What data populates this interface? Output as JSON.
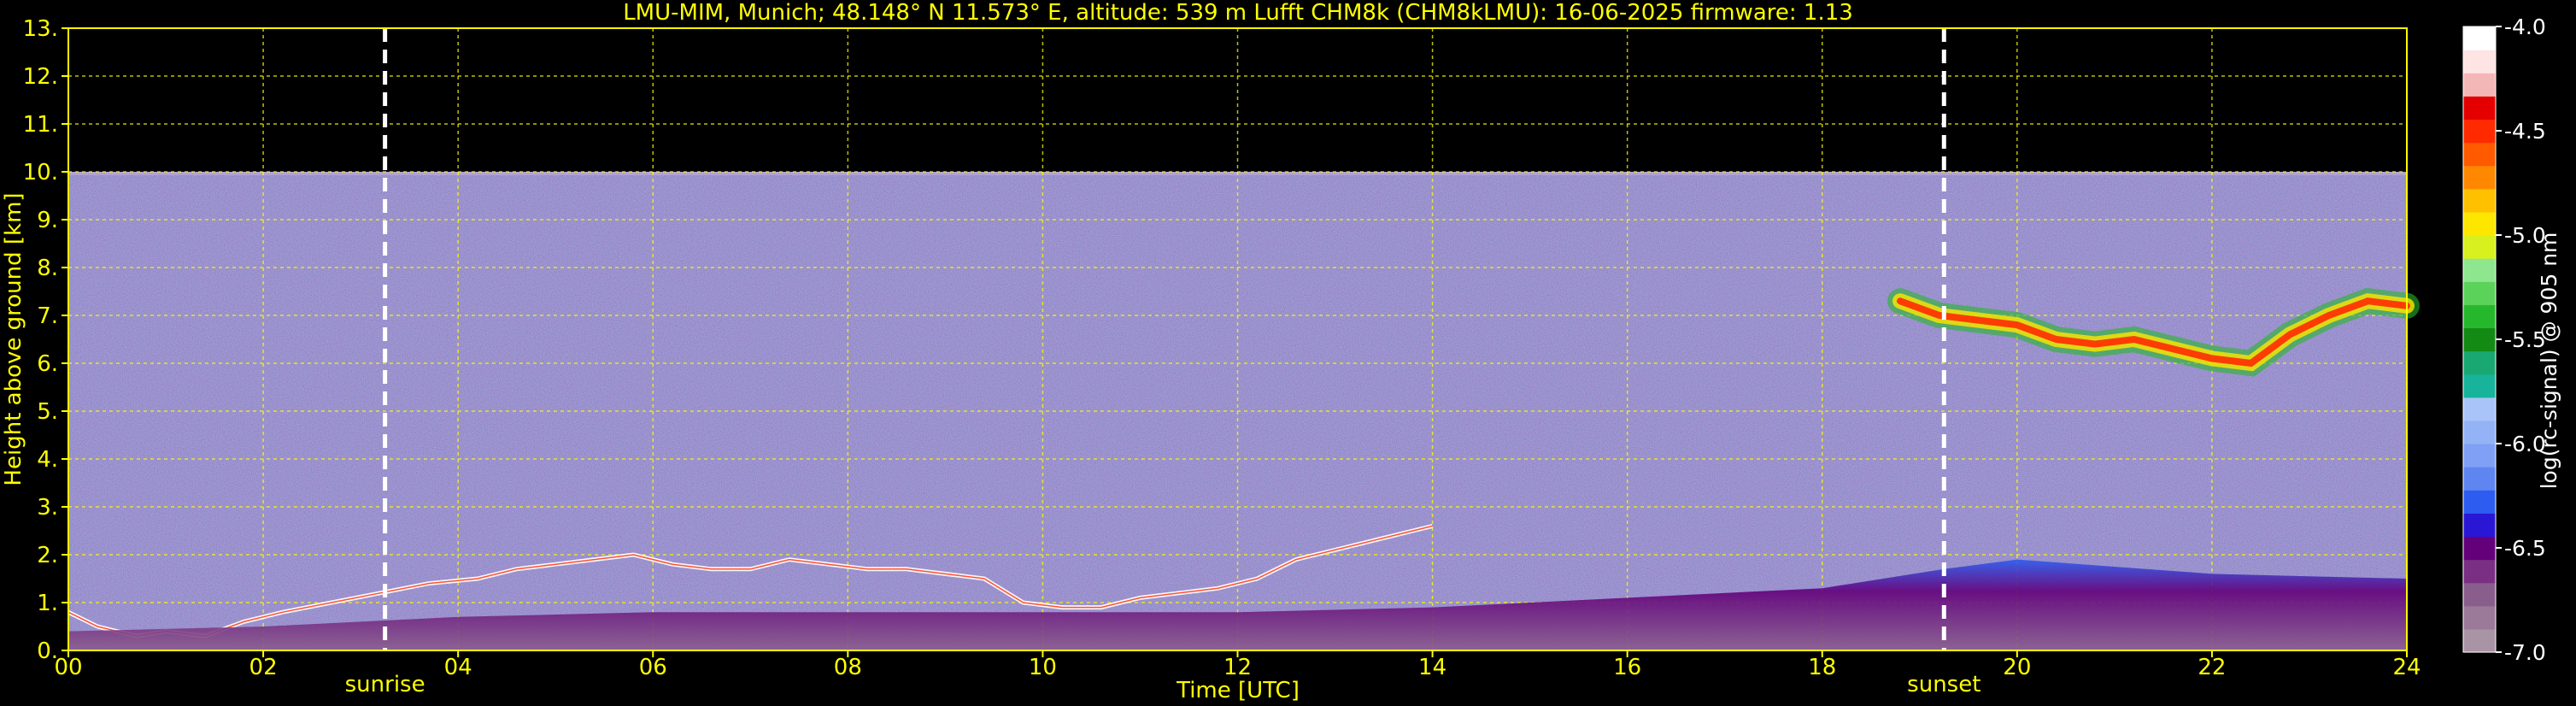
{
  "chart_data": {
    "type": "heatmap",
    "title": "LMU-MIM, Munich; 48.148° N 11.573° E, altitude: 539 m    Lufft CHM8k (CHM8kLMU): 16-06-2025    firmware: 1.13",
    "xlabel": "Time [UTC]",
    "ylabel": "Height above ground [km]",
    "xlim": [
      0,
      24
    ],
    "ylim": [
      0,
      13
    ],
    "x_ticks": [
      "00",
      "02",
      "04",
      "06",
      "08",
      "10",
      "12",
      "14",
      "16",
      "18",
      "20",
      "22",
      "24"
    ],
    "y_ticks": [
      "0.",
      "1.",
      "2.",
      "3.",
      "4.",
      "5.",
      "6.",
      "7.",
      "8.",
      "9.",
      "10.",
      "11.",
      "12.",
      "13."
    ],
    "grid": true,
    "data_ceiling_km": 10,
    "colorbar": {
      "label": "log(rc-signal) @ 905 nm",
      "range": [
        -7.0,
        -4.0
      ],
      "ticks": [
        "-4.0",
        "-4.5",
        "-5.0",
        "-5.5",
        "-6.0",
        "-6.5",
        "-7.0"
      ],
      "colors": [
        "#a994a6",
        "#9a7a98",
        "#8a5e8c",
        "#7a2f84",
        "#63007a",
        "#2a17d6",
        "#2c5cf0",
        "#5f86f0",
        "#7fa0f4",
        "#94b2f6",
        "#a9c4f8",
        "#17b39a",
        "#1aa872",
        "#128a14",
        "#26b82c",
        "#5bd35b",
        "#8ee68e",
        "#d7f01e",
        "#ffe600",
        "#ffc000",
        "#ff8800",
        "#ff5a00",
        "#ff2a00",
        "#e40000",
        "#f4b7b7",
        "#ffe4e4",
        "#ffffff"
      ]
    },
    "annotations": [
      {
        "label": "sunrise",
        "x": 3.25
      },
      {
        "label": "sunset",
        "x": 19.25
      }
    ],
    "layers": [
      {
        "kind": "cloud_base_line",
        "x": [
          0,
          0.3,
          0.7,
          1.0,
          1.4,
          1.8,
          2.2,
          2.7,
          3.2,
          3.7,
          4.2,
          4.6,
          5.0,
          5.4,
          5.8,
          6.2,
          6.6,
          7.0,
          7.4,
          7.8,
          8.2,
          8.6,
          9.0,
          9.4,
          9.8,
          10.2,
          10.6,
          11.0,
          11.4,
          11.8,
          12.2,
          12.6,
          13.0,
          13.4,
          13.8,
          14.0
        ],
        "y": [
          0.8,
          0.5,
          0.3,
          0.4,
          0.3,
          0.6,
          0.8,
          1.0,
          1.2,
          1.4,
          1.5,
          1.7,
          1.8,
          1.9,
          2.0,
          1.8,
          1.7,
          1.7,
          1.9,
          1.8,
          1.7,
          1.7,
          1.6,
          1.5,
          1.0,
          0.9,
          0.9,
          1.1,
          1.2,
          1.3,
          1.5,
          1.9,
          2.1,
          2.3,
          2.5,
          2.6
        ]
      },
      {
        "kind": "cirrus_layer",
        "x": [
          18.8,
          19.2,
          19.6,
          20.0,
          20.4,
          20.8,
          21.2,
          21.6,
          22.0,
          22.4,
          22.8,
          23.2,
          23.6,
          24.0
        ],
        "y": [
          7.3,
          7.0,
          6.9,
          6.8,
          6.5,
          6.4,
          6.5,
          6.3,
          6.1,
          6.0,
          6.6,
          7.0,
          7.3,
          7.2
        ]
      },
      {
        "kind": "aerosol_layer_top",
        "x": [
          0,
          2,
          4,
          6,
          8,
          10,
          12,
          14,
          16,
          18,
          19.25,
          20,
          22,
          24
        ],
        "y": [
          0.4,
          0.5,
          0.7,
          0.8,
          0.8,
          0.8,
          0.8,
          0.9,
          1.1,
          1.3,
          1.7,
          1.9,
          1.6,
          1.5
        ]
      }
    ]
  }
}
